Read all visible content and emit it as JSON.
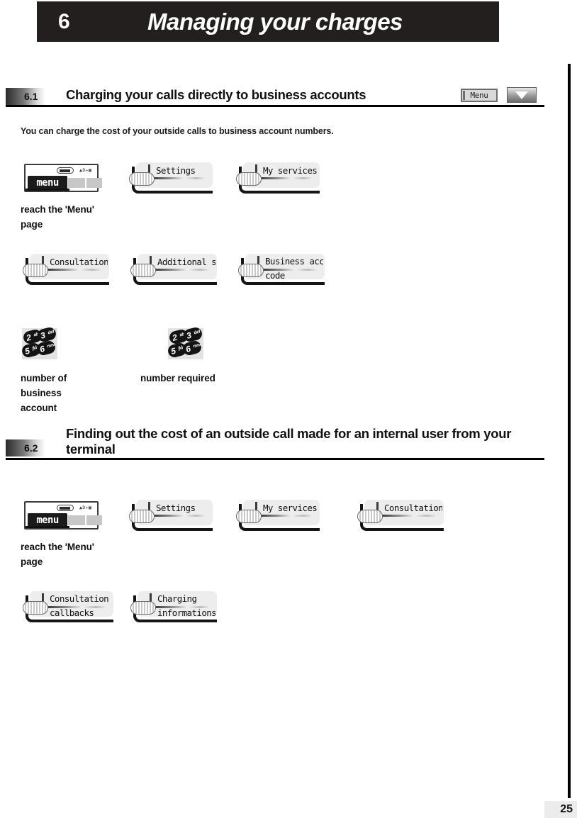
{
  "chapter": {
    "number": "6",
    "title": "Managing your charges"
  },
  "page_number": "25",
  "sections": [
    {
      "number": "6.1",
      "title": "Charging your calls directly to business accounts",
      "menu_badge": "Menu",
      "nav_arrow_icon": "triangle-down-icon",
      "intro": "You can charge the cost of your outside calls to business account numbers."
    },
    {
      "number": "6.2",
      "title": "Finding out the cost of an outside call made for an internal user from your terminal"
    }
  ],
  "captions": {
    "reach_menu_prefix": "reach the '",
    "reach_menu_bold": "Menu",
    "reach_menu_suffix": "'",
    "reach_menu_line2": "page",
    "number_of_business_account": "number of\nbusiness\naccount",
    "number_required": "number required"
  },
  "handset": {
    "menu_label": "menu",
    "status_glyphs": "▲D✛▩"
  },
  "keypad": {
    "keys": [
      {
        "digit": "2",
        "letters": "abc"
      },
      {
        "digit": "3",
        "letters": "def"
      },
      {
        "digit": "5",
        "letters": "jkl"
      },
      {
        "digit": "6",
        "letters": "mno"
      }
    ]
  },
  "softkeys": {
    "s61_row1": [
      {
        "label": "Settings"
      },
      {
        "label": "My services"
      }
    ],
    "s61_row2": [
      {
        "label": "Consultation"
      },
      {
        "label": "Additional servic"
      },
      {
        "label": "Business accoun\ncode"
      }
    ],
    "s62_row1": [
      {
        "label": "Settings"
      },
      {
        "label": "My services"
      },
      {
        "label": "Consultation"
      }
    ],
    "s62_row2": [
      {
        "label": "Consultation &\ncallbacks"
      },
      {
        "label": "Charging\ninformations"
      }
    ]
  },
  "colors": {
    "banner_bg": "#231f1e",
    "rule": "#000000",
    "panel_bg": "#ededed",
    "page_box_bg": "#ececec"
  }
}
